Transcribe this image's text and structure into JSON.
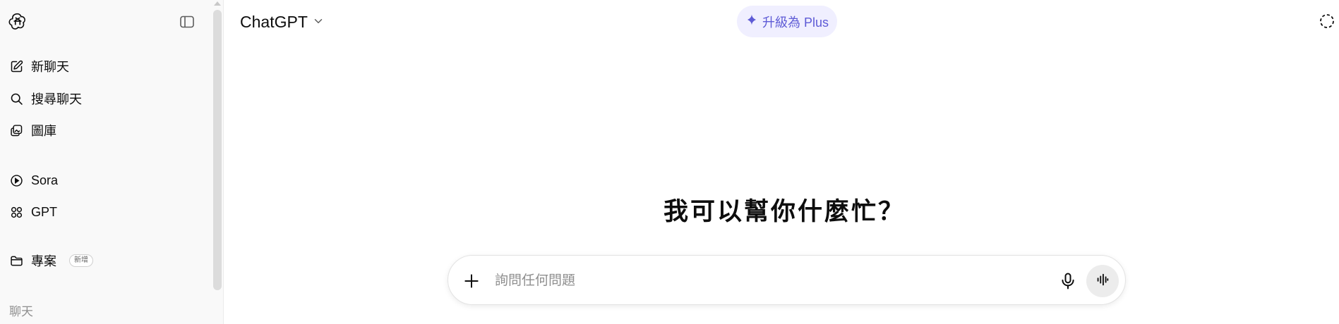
{
  "sidebar": {
    "items": [
      {
        "label": "新聊天",
        "icon": "new-chat-icon"
      },
      {
        "label": "搜尋聊天",
        "icon": "search-icon"
      },
      {
        "label": "圖庫",
        "icon": "library-icon"
      },
      {
        "label": "Sora",
        "icon": "play-circle-icon"
      },
      {
        "label": "GPT",
        "icon": "grid-icon"
      },
      {
        "label": "專案",
        "icon": "folder-icon",
        "badge": "新增"
      }
    ],
    "section_label": "聊天"
  },
  "header": {
    "model_name": "ChatGPT",
    "upgrade_label": "升級為 Plus"
  },
  "main": {
    "greeting": "我可以幫你什麼忙？",
    "composer": {
      "placeholder": "詢問任何問題",
      "value": ""
    }
  },
  "colors": {
    "sidebar_bg": "#f9f9f9",
    "upgrade_bg": "#f0efff",
    "upgrade_text": "#5e5bd6",
    "voice_btn_bg": "#ececec"
  }
}
